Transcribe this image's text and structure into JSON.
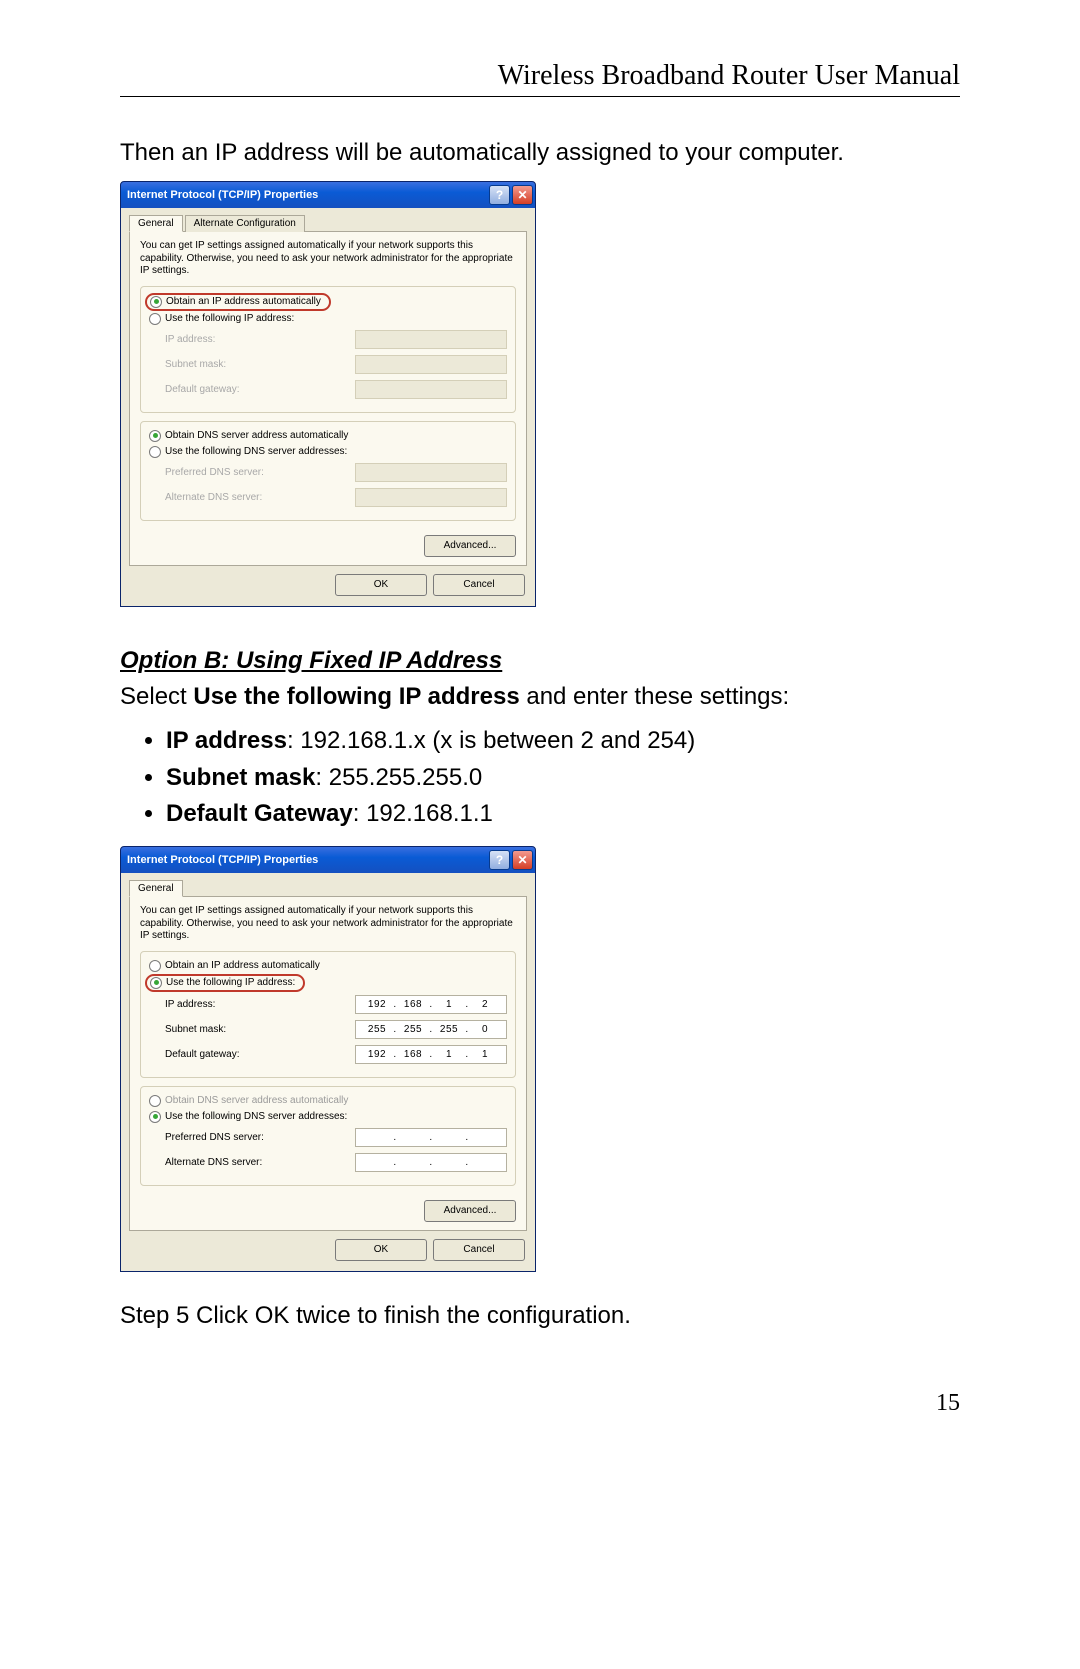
{
  "header": {
    "title": "Wireless Broadband Router User Manual"
  },
  "intro": "Then an IP address will be automatically assigned to your computer.",
  "dialog": {
    "title": "Internet Protocol (TCP/IP) Properties",
    "tabs": {
      "general": "General",
      "alt": "Alternate Configuration"
    },
    "note": "You can get IP settings assigned automatically if your network supports this capability. Otherwise, you need to ask your network administrator for the appropriate IP settings.",
    "radios": {
      "obtain_ip": "Obtain an IP address automatically",
      "use_ip": "Use the following IP address:",
      "obtain_dns": "Obtain DNS server address automatically",
      "use_dns": "Use the following DNS server addresses:"
    },
    "labels": {
      "ip": "IP address:",
      "subnet": "Subnet mask:",
      "gateway": "Default gateway:",
      "preferred_dns": "Preferred DNS server:",
      "alternate_dns": "Alternate DNS server:"
    },
    "buttons": {
      "advanced": "Advanced...",
      "ok": "OK",
      "cancel": "Cancel"
    }
  },
  "optionB": {
    "heading": "Option B: Using Fixed IP Address",
    "select_pre": "Select ",
    "select_bold": "Use the following IP address",
    "select_post": " and enter these settings:",
    "bullets": {
      "ip_label": "IP address",
      "ip_value": ": 192.168.1.x (x is between 2 and 254)",
      "subnet_label": "Subnet mask",
      "subnet_value": ": 255.255.255.0",
      "gateway_label": "Default Gateway",
      "gateway_value": ": 192.168.1.1"
    }
  },
  "dialog2": {
    "values": {
      "ip": [
        "192",
        "168",
        "1",
        "2"
      ],
      "subnet": [
        "255",
        "255",
        "255",
        "0"
      ],
      "gateway": [
        "192",
        "168",
        "1",
        "1"
      ],
      "pref_dns": [
        "",
        "",
        "",
        ""
      ],
      "alt_dns": [
        "",
        "",
        "",
        ""
      ]
    }
  },
  "step5": "Step 5 Click OK twice to finish the configuration.",
  "page_number": "15"
}
